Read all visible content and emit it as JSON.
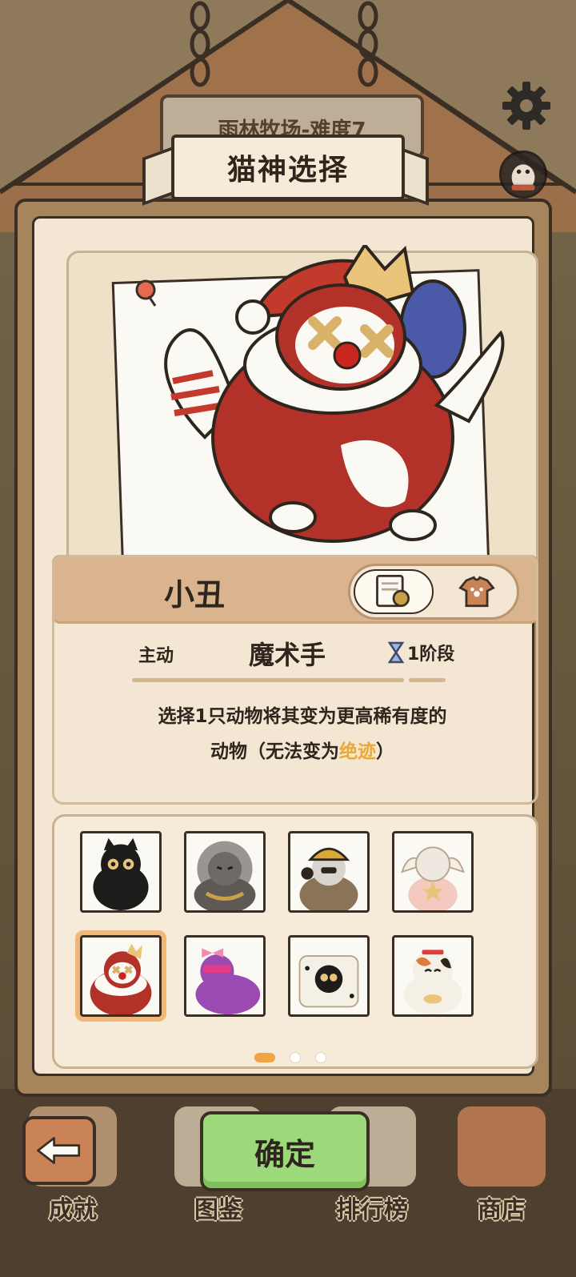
{
  "header": {
    "level_sign": "雨林牧场-难度7",
    "settings_icon": "gear-icon",
    "profile_icon": "penguin-avatar-icon"
  },
  "dialog": {
    "title": "猫神选择",
    "character": {
      "name": "小丑",
      "toggle_icons": [
        "certificate-icon",
        "shirt-icon"
      ]
    },
    "skill": {
      "type": "主动",
      "name": "魔术手",
      "stage": "1阶段",
      "stage_icon": "hourglass-icon"
    },
    "description": {
      "line1": "选择1只动物将其变为更高稀有度的",
      "line2_prefix": "动物（无法变为",
      "line2_highlight": "绝迹",
      "line2_suffix": "）",
      "highlight_color": "#e8a938"
    },
    "grid": {
      "items": [
        {
          "name": "black-cat",
          "selected": false
        },
        {
          "name": "gray-lion-cat",
          "selected": false
        },
        {
          "name": "miner-cat",
          "selected": false
        },
        {
          "name": "angel-cat",
          "selected": false
        },
        {
          "name": "clown-cat",
          "selected": true
        },
        {
          "name": "purple-bow-cat",
          "selected": false
        },
        {
          "name": "dice-cat",
          "selected": false
        },
        {
          "name": "calico-lucky-cat",
          "selected": false
        }
      ],
      "page_index": 0,
      "page_count": 3
    }
  },
  "bottom_nav": {
    "items": [
      {
        "label": "成就"
      },
      {
        "label": "图鉴"
      },
      {
        "label": "排行榜"
      },
      {
        "label": "商店"
      }
    ],
    "back_icon": "back-arrow-icon",
    "confirm_label": "确定",
    "confirm_color": "#9cd97a"
  }
}
